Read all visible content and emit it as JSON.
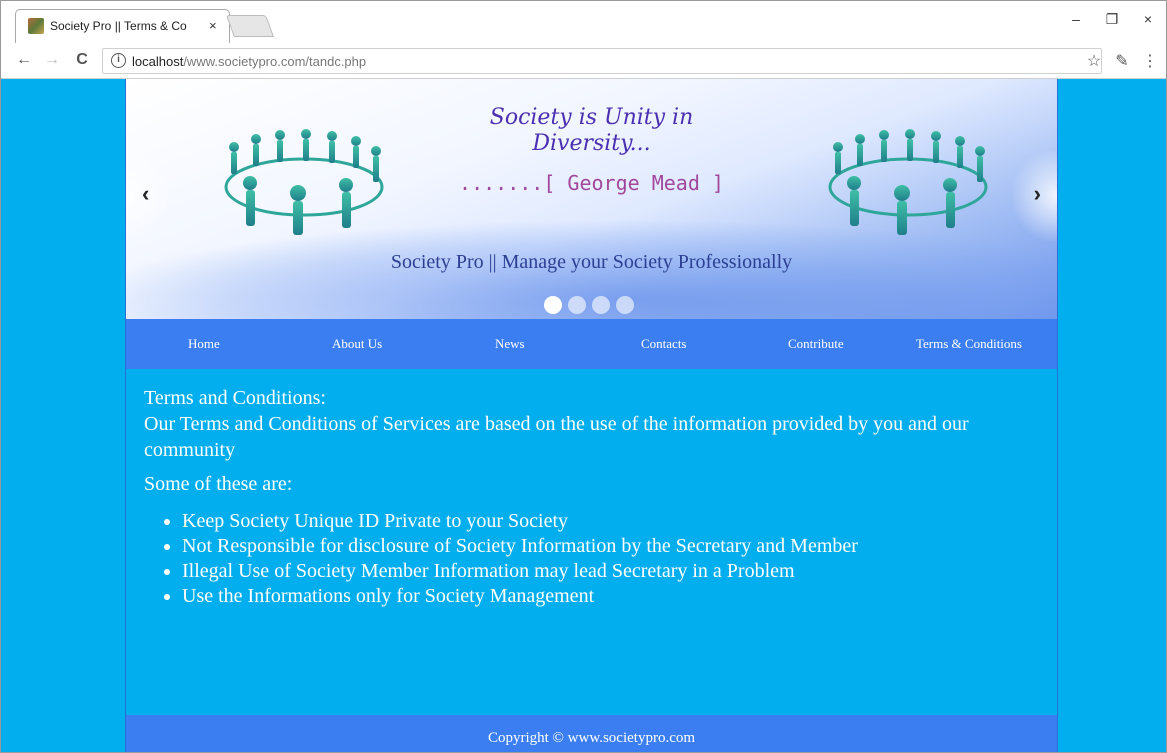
{
  "browser": {
    "tab_title": "Society Pro || Terms & Co",
    "tab_close": "×",
    "url_host": "localhost",
    "url_path": "/www.societypro.com/tandc.php",
    "controls": {
      "minimize": "–",
      "maximize": "❐",
      "close": "×"
    },
    "nav": {
      "back": "←",
      "forward": "→",
      "reload": "C"
    },
    "info_glyph": "i",
    "star": "☆",
    "menu": "⋮",
    "extension": "✎"
  },
  "banner": {
    "quote_line1": "Society is Unity in",
    "quote_line2": "Diversity...",
    "author": ".......[ George Mead ]",
    "tagline": "Society Pro || Manage your Society Professionally",
    "prev": "‹",
    "next": "›",
    "slide_count": 4,
    "active_slide": 1
  },
  "menu": {
    "items": [
      "Home",
      "About Us",
      "News",
      "Contacts",
      "Contribute",
      "Terms & Conditions"
    ]
  },
  "content": {
    "heading": "Terms and Conditions:",
    "intro": "Our Terms and Conditions of Services are based on the use of the information provided by you and our community",
    "subhead": "Some of these are:",
    "items": [
      "Keep Society Unique ID Private to your Society",
      "Not Responsible for disclosure of Society Information by the Secretary and Member",
      "Illegal Use of Society Member Information may lead Secretary in a Problem",
      "Use the Informations only for Society Management"
    ]
  },
  "footer": {
    "text": "Copyright © www.societypro.com"
  },
  "colors": {
    "page_bg": "#03aeee",
    "menu_bg": "#3b7ef2",
    "quote": "#4a2fb0",
    "tagline": "#2c3f92"
  }
}
